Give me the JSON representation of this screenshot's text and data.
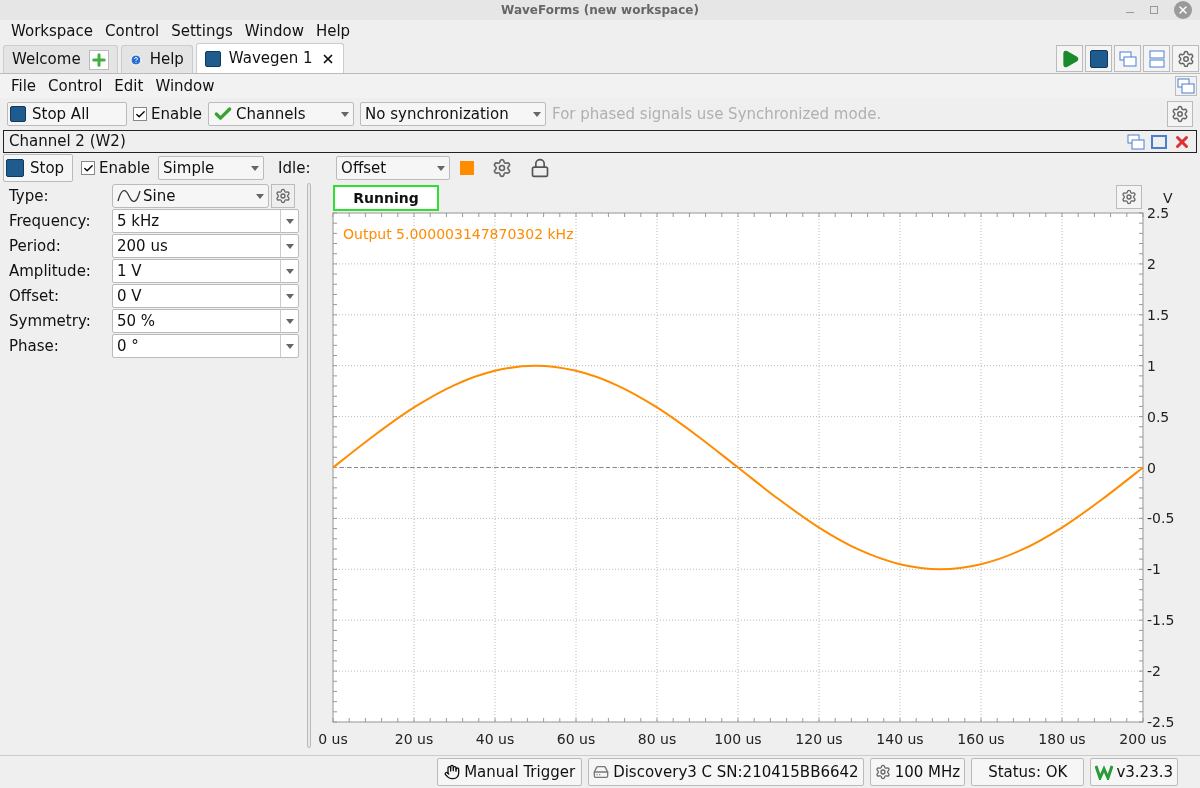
{
  "window": {
    "title": "WaveForms (new workspace)"
  },
  "menu": [
    "Workspace",
    "Control",
    "Settings",
    "Window",
    "Help"
  ],
  "tabs": [
    {
      "label": "Welcome",
      "kind": "add",
      "selected": false
    },
    {
      "label": "Help",
      "kind": "help",
      "selected": false
    },
    {
      "label": "Wavegen 1",
      "kind": "tool",
      "selected": true
    }
  ],
  "submenu": [
    "File",
    "Control",
    "Edit",
    "Window"
  ],
  "toolbar": {
    "stop_all": "Stop All",
    "enable": {
      "label": "Enable",
      "checked": true
    },
    "channels": "Channels",
    "sync": "No synchronization",
    "hint": "For phased signals use Synchronized mode."
  },
  "channel": {
    "title": "Channel 2 (W2)",
    "stop": "Stop",
    "enable": {
      "label": "Enable",
      "checked": true
    },
    "mode": "Simple",
    "idle_label": "Idle:",
    "idle": "Offset"
  },
  "params": [
    {
      "label": "Type:",
      "value": "Sine",
      "kind": "type"
    },
    {
      "label": "Frequency:",
      "value": "5 kHz",
      "kind": "combo"
    },
    {
      "label": "Period:",
      "value": "200 us",
      "kind": "combo"
    },
    {
      "label": "Amplitude:",
      "value": "1 V",
      "kind": "combo"
    },
    {
      "label": "Offset:",
      "value": "0 V",
      "kind": "combo"
    },
    {
      "label": "Symmetry:",
      "value": "50 %",
      "kind": "combo"
    },
    {
      "label": "Phase:",
      "value": "0 °",
      "kind": "combo"
    }
  ],
  "plot": {
    "status": "Running",
    "output": "Output 5.000003147870302 kHz",
    "chart_data": {
      "type": "line",
      "ylabel": "V",
      "x": [
        0,
        10,
        20,
        30,
        40,
        50,
        60,
        70,
        80,
        90,
        100,
        110,
        120,
        130,
        140,
        150,
        160,
        170,
        180,
        190,
        200
      ],
      "series": [
        {
          "color": "#ff8c00",
          "values": [
            0,
            0.31,
            0.59,
            0.81,
            0.95,
            1,
            0.95,
            0.81,
            0.59,
            0.31,
            0,
            -0.31,
            -0.59,
            -0.81,
            -0.95,
            -1,
            -0.95,
            -0.81,
            -0.59,
            -0.31,
            0
          ]
        }
      ],
      "grid": true,
      "ref_lines": [
        {
          "axis": "y",
          "value": 0
        }
      ],
      "xlim": [
        0,
        200
      ],
      "ylim": [
        -2.5,
        2.5
      ],
      "xticks": [
        {
          "value": 0,
          "label": "0 us"
        },
        {
          "value": 20,
          "label": "20 us"
        },
        {
          "value": 40,
          "label": "40 us"
        },
        {
          "value": 60,
          "label": "60 us"
        },
        {
          "value": 80,
          "label": "80 us"
        },
        {
          "value": 100,
          "label": "100 us"
        },
        {
          "value": 120,
          "label": "120 us"
        },
        {
          "value": 140,
          "label": "140 us"
        },
        {
          "value": 160,
          "label": "160 us"
        },
        {
          "value": 180,
          "label": "180 us"
        },
        {
          "value": 200,
          "label": "200 us"
        }
      ],
      "yticks": [
        {
          "value": 2.5,
          "label": "2.5"
        },
        {
          "value": 2,
          "label": "2"
        },
        {
          "value": 1.5,
          "label": "1.5"
        },
        {
          "value": 1,
          "label": "1"
        },
        {
          "value": 0.5,
          "label": "0.5"
        },
        {
          "value": 0,
          "label": "0"
        },
        {
          "value": -0.5,
          "label": "-0.5"
        },
        {
          "value": -1,
          "label": "-1"
        },
        {
          "value": -1.5,
          "label": "-1.5"
        },
        {
          "value": -2,
          "label": "-2"
        },
        {
          "value": -2.5,
          "label": "-2.5"
        }
      ]
    }
  },
  "status_bar": {
    "trigger": "Manual Trigger",
    "device": "Discovery3 C SN:210415BB6642",
    "clock": "100 MHz",
    "status": "Status: OK",
    "version": "v3.23.3"
  }
}
